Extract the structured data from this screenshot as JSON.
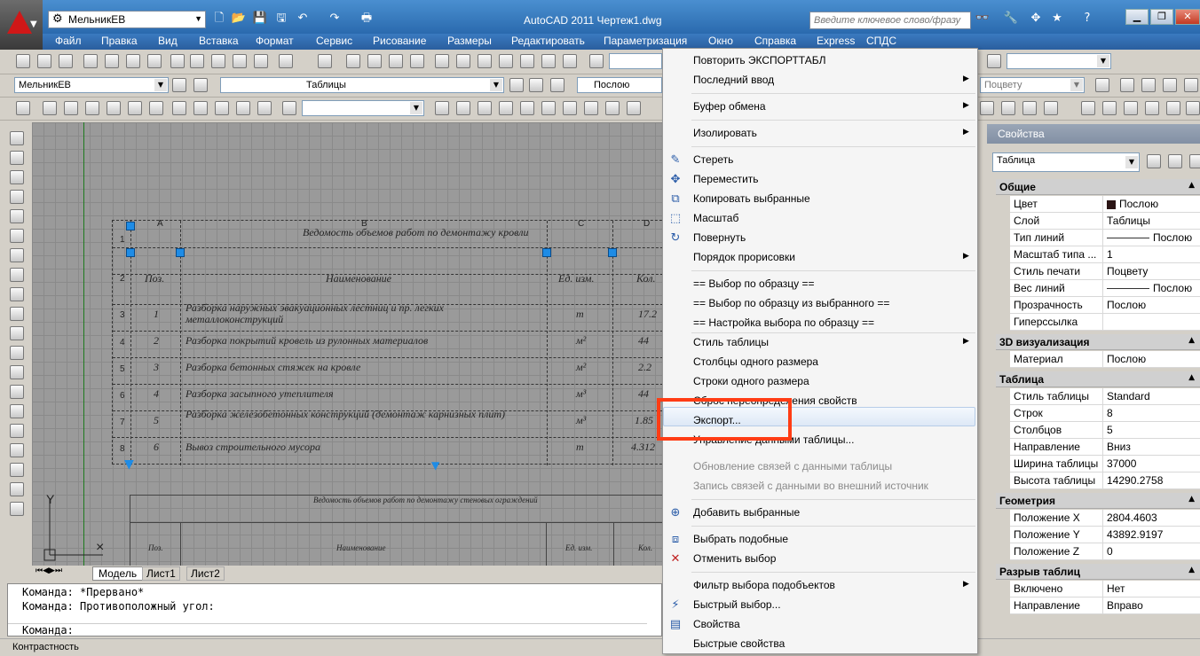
{
  "title": {
    "workspace": "МельникЕВ",
    "app_title": "AutoCAD 2011     Чертеж1.dwg",
    "search_placeholder": "Введите ключевое слово/фразу"
  },
  "menubar": [
    "Файл",
    "Правка",
    "Вид",
    "Вставка",
    "Формат",
    "Сервис",
    "Рисование",
    "Размеры",
    "Редактировать",
    "Параметризация",
    "Окно",
    "Справка",
    "Express",
    "СПДС"
  ],
  "toolbar": {
    "layer_state": "МельникЕВ",
    "layer": "Таблицы",
    "color": "Послою",
    "plotstyle": "Поцвету"
  },
  "table": {
    "title": "Ведомость объемов работ по  демонтажу кровли",
    "col_letters": [
      "A",
      "B",
      "C",
      "D"
    ],
    "headers": [
      "Поз.",
      "Наименование",
      "Ед. изм.",
      "Кол."
    ],
    "rows": [
      {
        "n": "3",
        "pos": "1",
        "name": "Разборка наружных эвакуационных лестниц и пр. легких металлоконструкций",
        "unit": "т",
        "qty": "17.2"
      },
      {
        "n": "4",
        "pos": "2",
        "name": "Разборка покрытий кровель из рулонных материалов",
        "unit": "м²",
        "qty": "44"
      },
      {
        "n": "5",
        "pos": "3",
        "name": "Разборка бетонных стяжек на кровле",
        "unit": "м²",
        "qty": "2.2"
      },
      {
        "n": "6",
        "pos": "4",
        "name": "Разборка засыпного утеплителя",
        "unit": "м³",
        "qty": "44"
      },
      {
        "n": "7",
        "pos": "5",
        "name": "Разборка железобетонных конструкций (демонтаж карнизных плит)",
        "unit": "м³",
        "qty": "1.85"
      },
      {
        "n": "8",
        "pos": "6",
        "name": "Вывоз строительного мусора",
        "unit": "т",
        "qty": "4.312"
      }
    ],
    "row_nums": [
      "1",
      "2"
    ]
  },
  "table2": {
    "title": "Ведомость объемов работ по  демонтажу стеновых ограждений",
    "headers": [
      "Поз.",
      "Наименование",
      "Ед. изм.",
      "Кол."
    ]
  },
  "tabs": [
    "Модель",
    "Лист1",
    "Лист2"
  ],
  "command": {
    "lines": [
      "Команда: *Прервано*",
      "Команда: Противоположный угол:"
    ],
    "prompt": "Команда:"
  },
  "status": "Контрастность",
  "menu": {
    "items": [
      "Повторить ЭКСПОРТТАБЛ",
      "Последний ввод",
      "Буфер обмена",
      "Изолировать",
      "Стереть",
      "Переместить",
      "Копировать выбранные",
      "Масштаб",
      "Повернуть",
      "Порядок прорисовки",
      "== Выбор по образцу ==",
      "== Выбор по образцу из выбранного ==",
      "== Настройка выбора по образцу ==",
      "Стиль таблицы",
      "Столбцы одного размера",
      "Строки одного размера",
      "Сброс переопределения свойств",
      "Экспорт...",
      "Управление данными таблицы...",
      "Обновление связей с данными таблицы",
      "Запись связей с данными во внешний источник",
      "Добавить выбранные",
      "Выбрать подобные",
      "Отменить выбор",
      "Фильтр выбора подобъектов",
      "Быстрый выбор...",
      "Свойства",
      "Быстрые свойства"
    ]
  },
  "props": {
    "header": "Свойства",
    "selector": "Таблица",
    "sections": [
      {
        "name": "Общие",
        "rows": [
          [
            "Цвет",
            "Послою"
          ],
          [
            "Слой",
            "Таблицы"
          ],
          [
            "Тип линий",
            "Послою"
          ],
          [
            "Масштаб типа ...",
            "1"
          ],
          [
            "Стиль печати",
            "Поцвету"
          ],
          [
            "Вес линий",
            "Послою"
          ],
          [
            "Прозрачность",
            "Послою"
          ],
          [
            "Гиперссылка",
            ""
          ]
        ]
      },
      {
        "name": "3D визуализация",
        "rows": [
          [
            "Материал",
            "Послою"
          ]
        ]
      },
      {
        "name": "Таблица",
        "rows": [
          [
            "Стиль таблицы",
            "Standard"
          ],
          [
            "Строк",
            "8"
          ],
          [
            "Столбцов",
            "5"
          ],
          [
            "Направление",
            "Вниз"
          ],
          [
            "Ширина таблицы",
            "37000"
          ],
          [
            "Высота таблицы",
            "14290.2758"
          ]
        ]
      },
      {
        "name": "Геометрия",
        "rows": [
          [
            "Положение X",
            "2804.4603"
          ],
          [
            "Положение Y",
            "43892.9197"
          ],
          [
            "Положение Z",
            "0"
          ]
        ]
      },
      {
        "name": "Разрыв таблиц",
        "rows": [
          [
            "Включено",
            "Нет"
          ],
          [
            "Направление",
            "Вправо"
          ]
        ]
      }
    ]
  },
  "colors": {
    "title_bar": "#2a6aae",
    "highlight_box": "#ff3c14",
    "canvas": "#9a9a9a"
  }
}
